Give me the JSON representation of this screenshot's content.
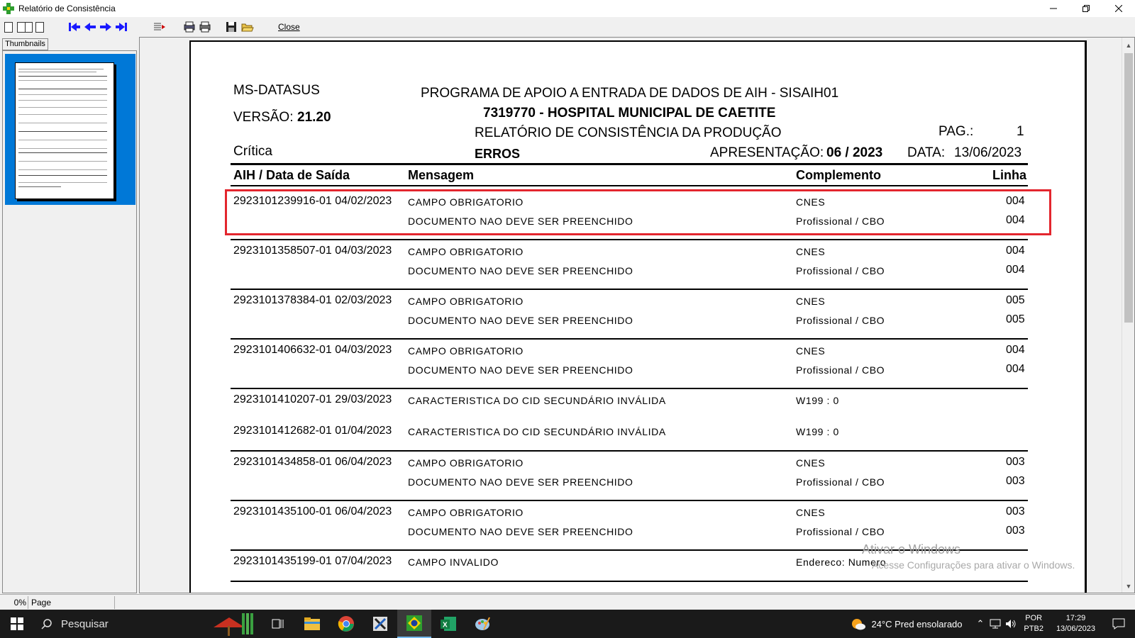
{
  "window": {
    "title": "Relatório de Consistência"
  },
  "toolbar": {
    "close_label": "Close"
  },
  "thumbnails": {
    "tab_label": "Thumbnails"
  },
  "report": {
    "org": "MS-DATASUS",
    "version_label": "VERSÃO:",
    "version": "21.20",
    "program": "PROGRAMA DE APOIO A ENTRADA DE DADOS DE AIH - SISAIH01",
    "hospital": "7319770 - HOSPITAL MUNICIPAL DE CAETITE",
    "report_title": "RELATÓRIO DE CONSISTÊNCIA DA PRODUÇÃO",
    "page_label": "PAG.:",
    "page_number": "1",
    "critica_label": "Crítica",
    "type": "ERROS",
    "presentation_label": "APRESENTAÇÃO:",
    "presentation": "06 / 2023",
    "date_label": "DATA:",
    "date": "13/06/2023",
    "headers": {
      "aih": "AIH  /  Data de Saída",
      "message": "Mensagem",
      "complement": "Complemento",
      "line": "Linha"
    },
    "rows": [
      {
        "aih": "2923101239916-01 04/02/2023",
        "items": [
          {
            "message": "CAMPO OBRIGATORIO",
            "complement": "CNES",
            "line": "004"
          },
          {
            "message": "DOCUMENTO NAO DEVE SER PREENCHIDO",
            "complement": "Profissional / CBO",
            "line": "004"
          }
        ]
      },
      {
        "aih": "2923101358507-01 04/03/2023",
        "items": [
          {
            "message": "CAMPO OBRIGATORIO",
            "complement": "CNES",
            "line": "004"
          },
          {
            "message": "DOCUMENTO NAO DEVE SER PREENCHIDO",
            "complement": "Profissional / CBO",
            "line": "004"
          }
        ]
      },
      {
        "aih": "2923101378384-01 02/03/2023",
        "items": [
          {
            "message": "CAMPO OBRIGATORIO",
            "complement": "CNES",
            "line": "005"
          },
          {
            "message": "DOCUMENTO NAO DEVE SER PREENCHIDO",
            "complement": "Profissional / CBO",
            "line": "005"
          }
        ]
      },
      {
        "aih": "2923101406632-01 04/03/2023",
        "items": [
          {
            "message": "CAMPO OBRIGATORIO",
            "complement": "CNES",
            "line": "004"
          },
          {
            "message": "DOCUMENTO NAO DEVE SER PREENCHIDO",
            "complement": "Profissional / CBO",
            "line": "004"
          }
        ]
      },
      {
        "aih": "2923101410207-01 29/03/2023",
        "items": [
          {
            "message": "CARACTERISTICA DO CID SECUNDÁRIO INVÁLIDA",
            "complement": "W199 : 0",
            "line": ""
          }
        ]
      },
      {
        "aih": "2923101412682-01 01/04/2023",
        "items": [
          {
            "message": "CARACTERISTICA DO CID SECUNDÁRIO INVÁLIDA",
            "complement": "W199 : 0",
            "line": ""
          }
        ]
      },
      {
        "aih": "2923101434858-01 06/04/2023",
        "items": [
          {
            "message": "CAMPO OBRIGATORIO",
            "complement": "CNES",
            "line": "003"
          },
          {
            "message": "DOCUMENTO NAO DEVE SER PREENCHIDO",
            "complement": "Profissional / CBO",
            "line": "003"
          }
        ]
      },
      {
        "aih": "2923101435100-01 06/04/2023",
        "items": [
          {
            "message": "CAMPO OBRIGATORIO",
            "complement": "CNES",
            "line": "003"
          },
          {
            "message": "DOCUMENTO NAO DEVE SER PREENCHIDO",
            "complement": "Profissional / CBO",
            "line": "003"
          }
        ]
      },
      {
        "aih": "2923101435199-01 07/04/2023",
        "items": [
          {
            "message": "CAMPO INVALIDO",
            "complement": "Endereco: Numero",
            "line": ""
          }
        ]
      }
    ]
  },
  "watermark": {
    "line1": "Ativar o Windows",
    "line2": "Acesse Configurações para ativar o Windows."
  },
  "statusbar": {
    "percent": "0%",
    "page": "Page"
  },
  "taskbar": {
    "search_placeholder": "Pesquisar",
    "weather": "24°C  Pred ensolarado",
    "lang1": "POR",
    "lang2": "PTB2",
    "time": "17:29",
    "date": "13/06/2023"
  },
  "colors": {
    "highlight": "#e3262e",
    "thumb_selected": "#0078d7",
    "nav_arrow": "#1a1aff"
  }
}
